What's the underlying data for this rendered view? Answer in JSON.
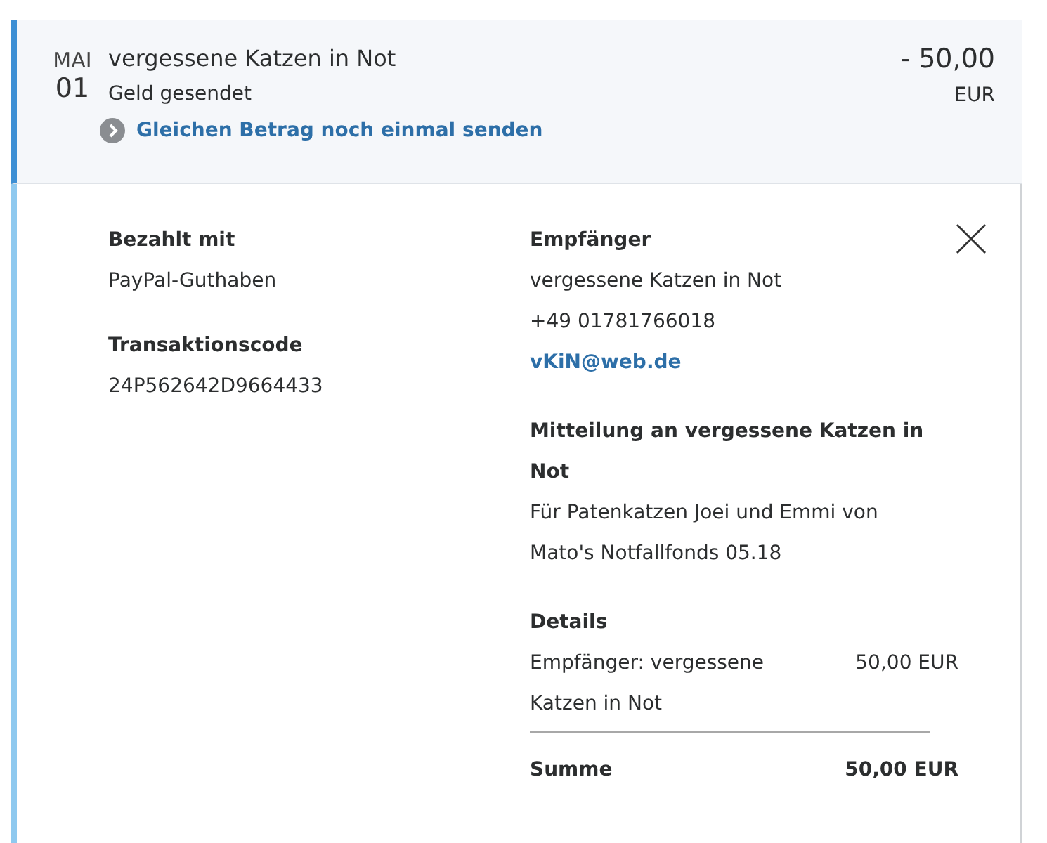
{
  "transaction": {
    "month": "MAI",
    "day": "01",
    "name": "vergessene Katzen in Not",
    "status": "Geld gesendet",
    "amount": "- 50,00",
    "currency": "EUR",
    "repeat_link": "Gleichen Betrag noch einmal senden"
  },
  "details": {
    "left": [
      {
        "label": "Bezahlt mit",
        "value": "PayPal-Guthaben"
      },
      {
        "label": "Transaktionscode",
        "value": "24P562642D9664433"
      }
    ],
    "recipient": {
      "label": "Empfänger",
      "name": "vergessene Katzen in Not",
      "phone": "+49 01781766018",
      "email": "vKiN@web.de"
    },
    "message": {
      "label": "Mitteilung an vergessene Katzen in Not",
      "text": "Für Patenkatzen Joei und Emmi von Mato's Notfallfonds 05.18"
    },
    "breakdown": {
      "label": "Details",
      "lines": [
        {
          "item": "Empfänger: vergessene Katzen in Not",
          "amount": "50,00 EUR"
        }
      ],
      "total_label": "Summe",
      "total": "50,00 EUR"
    }
  }
}
